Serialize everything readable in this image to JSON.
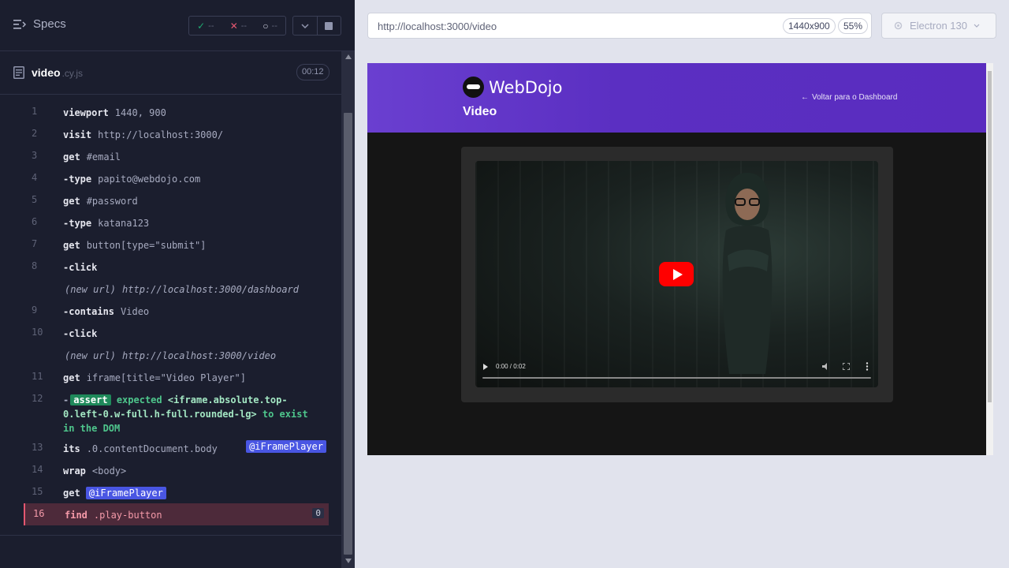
{
  "reporter": {
    "title": "Specs",
    "stats": {
      "passed": "--",
      "failed": "--",
      "pending": "--"
    },
    "spec": {
      "name": "video",
      "ext": ".cy.js",
      "duration": "00:12"
    },
    "commands": [
      {
        "num": "1",
        "name": "viewport",
        "msg": "1440, 900"
      },
      {
        "num": "2",
        "name": "visit",
        "msg": "http://localhost:3000/"
      },
      {
        "num": "3",
        "name": "get",
        "msg": "#email"
      },
      {
        "num": "4",
        "name": "-type",
        "msg": "papito@webdojo.com"
      },
      {
        "num": "5",
        "name": "get",
        "msg": "#password"
      },
      {
        "num": "6",
        "name": "-type",
        "msg": "katana123"
      },
      {
        "num": "7",
        "name": "get",
        "msg": "button[type=\"submit\"]"
      },
      {
        "num": "8",
        "name": "-click",
        "msg": ""
      },
      {
        "num": "",
        "name": "(new url)",
        "msg": "http://localhost:3000/dashboard"
      },
      {
        "num": "9",
        "name": "-contains",
        "msg": "Video"
      },
      {
        "num": "10",
        "name": "-click",
        "msg": ""
      },
      {
        "num": "",
        "name": "(new url)",
        "msg": "http://localhost:3000/video"
      },
      {
        "num": "11",
        "name": "get",
        "msg": "iframe[title=\"Video Player\"]"
      },
      {
        "num": "12",
        "name": "assert",
        "msg_prefix": "expected",
        "msg_subject": "<iframe.absolute.top-0.left-0.w-full.h-full.rounded-lg>",
        "msg_suffix": "to exist in the DOM"
      },
      {
        "num": "13",
        "name": "its",
        "msg": ".0.contentDocument.body",
        "alias": "@iFramePlayer"
      },
      {
        "num": "14",
        "name": "wrap",
        "msg": "<body>"
      },
      {
        "num": "15",
        "name": "get",
        "alias": "@iFramePlayer"
      },
      {
        "num": "16",
        "name": "find",
        "msg": ".play-button",
        "count": "0"
      }
    ]
  },
  "browser": {
    "url": "http://localhost:3000/video",
    "viewport": "1440x900",
    "zoom": "55%",
    "name": "Electron 130"
  },
  "app": {
    "logo": "WebDojo",
    "page_title": "Video",
    "back_link": "Voltar para o Dashboard",
    "video_time": "0:00 / 0:02",
    "video_progress": 0
  },
  "colors": {
    "passed": "#1fa971",
    "failed": "#e45770",
    "alias": "#4956e3",
    "hero": "#5b2fc2",
    "play": "#ff0000"
  }
}
